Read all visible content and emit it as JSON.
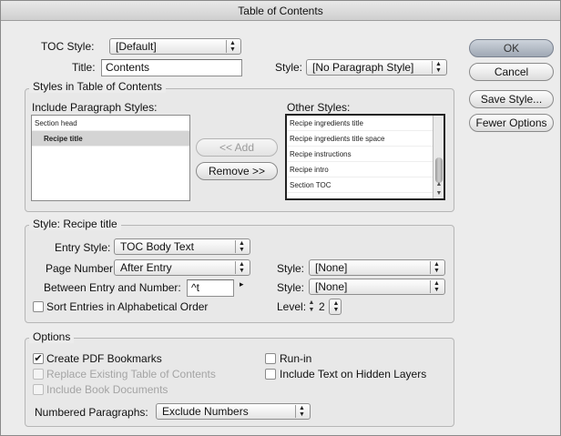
{
  "window": {
    "title": "Table of Contents"
  },
  "header": {
    "toc_style_label": "TOC Style:",
    "toc_style_value": "[Default]",
    "title_label": "Title:",
    "title_value": "Contents",
    "style_label": "Style:",
    "style_value": "[No Paragraph Style]"
  },
  "buttons": {
    "ok": "OK",
    "cancel": "Cancel",
    "save_style": "Save Style...",
    "fewer_options": "Fewer Options",
    "add": "<< Add",
    "remove": "Remove >>"
  },
  "styles_group": {
    "title": "Styles in Table of Contents",
    "include_label": "Include Paragraph Styles:",
    "include_items": [
      "Section head",
      "Recipe title"
    ],
    "other_label": "Other Styles:",
    "other_items": [
      "Recipe ingredients title",
      "Recipe ingredients title space",
      "Recipe instructions",
      "Recipe intro",
      "Section TOC"
    ]
  },
  "style_group": {
    "title": "Style: Recipe title",
    "entry_style_label": "Entry Style:",
    "entry_style_value": "TOC Body Text",
    "page_number_label": "Page Number:",
    "page_number_value": "After Entry",
    "page_number_style_label": "Style:",
    "page_number_style_value": "[None]",
    "between_label": "Between Entry and Number:",
    "between_value": "^t",
    "between_style_label": "Style:",
    "between_style_value": "[None]",
    "sort_label": "Sort Entries in Alphabetical Order",
    "level_label": "Level:",
    "level_value": "2"
  },
  "options_group": {
    "title": "Options",
    "create_pdf": "Create PDF Bookmarks",
    "replace_existing": "Replace Existing Table of Contents",
    "include_book": "Include Book Documents",
    "run_in": "Run-in",
    "include_hidden": "Include Text on Hidden Layers",
    "numbered_label": "Numbered Paragraphs:",
    "numbered_value": "Exclude Numbers"
  },
  "icons": {
    "popup_arrows": "▲▼",
    "check": "✔"
  },
  "colors": {
    "default_button": "#aab2bd",
    "selection": "#d4d4d4"
  }
}
